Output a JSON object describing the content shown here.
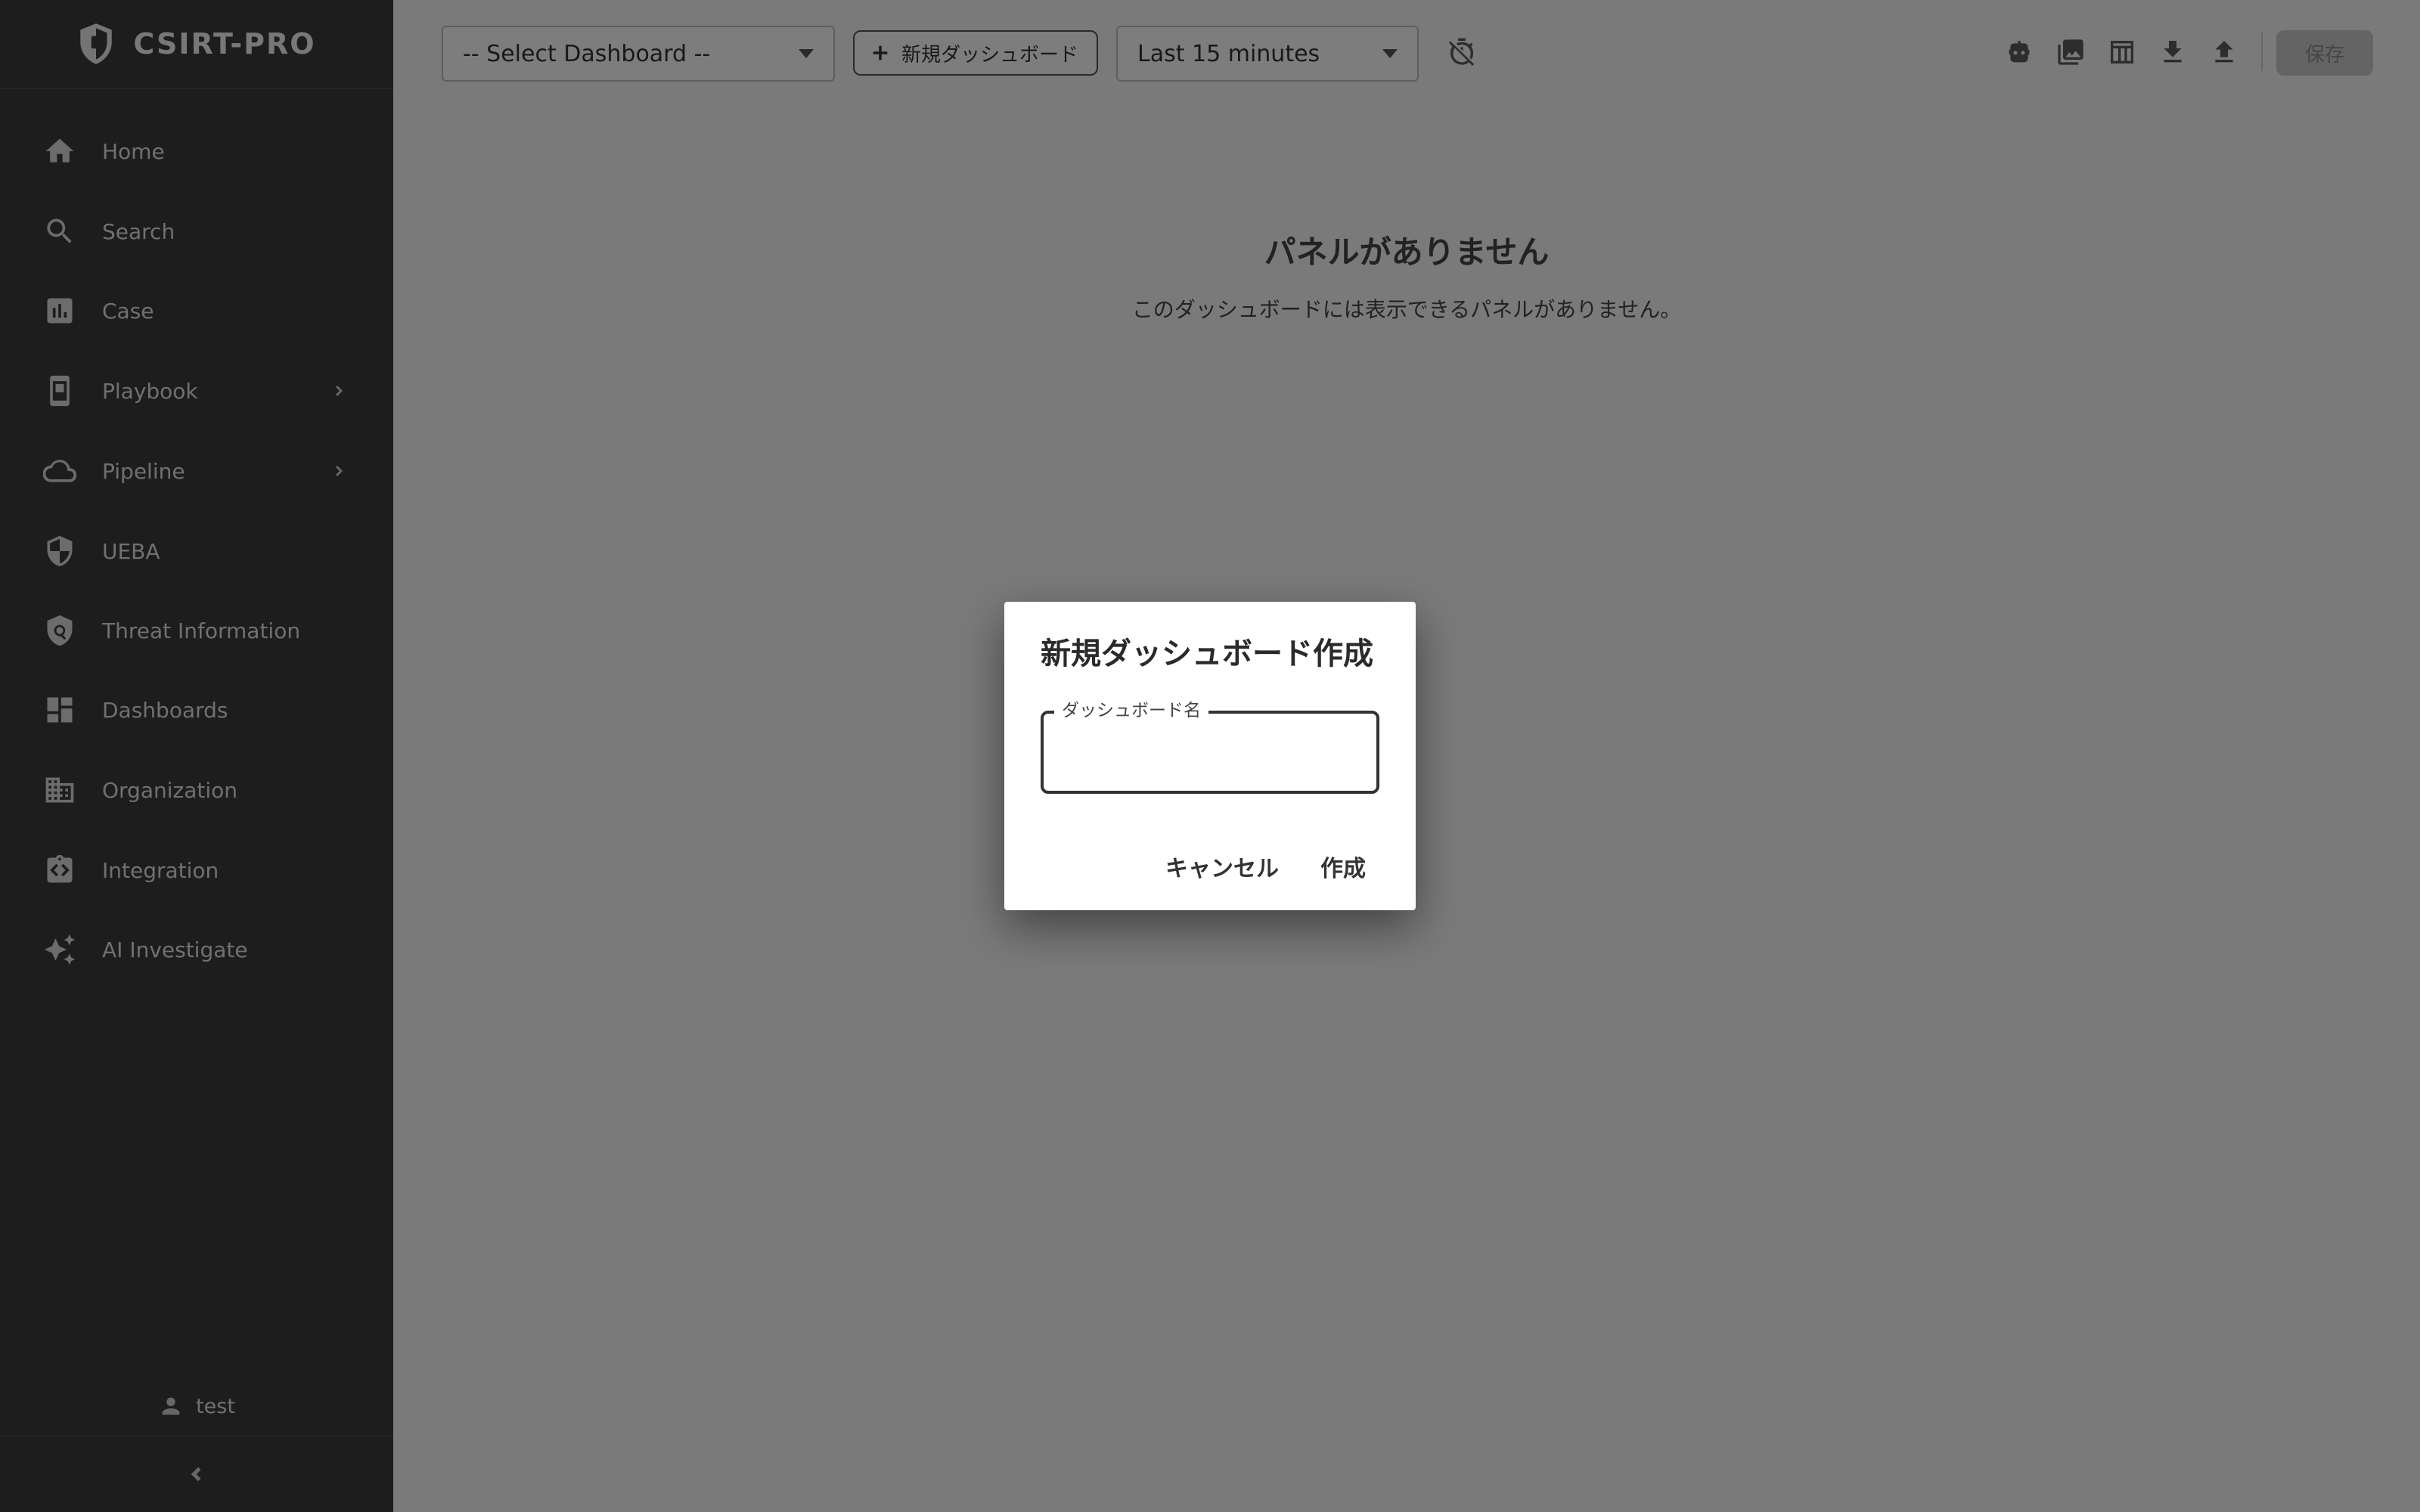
{
  "brand": {
    "title": "CSIRT-PRO",
    "icon": "shield-icon"
  },
  "sidebar": {
    "items": [
      {
        "label": "Home",
        "icon": "home-icon",
        "expandable": false
      },
      {
        "label": "Search",
        "icon": "search-icon",
        "expandable": false
      },
      {
        "label": "Case",
        "icon": "bar-chart-icon",
        "expandable": false
      },
      {
        "label": "Playbook",
        "icon": "book-icon",
        "expandable": true
      },
      {
        "label": "Pipeline",
        "icon": "cloud-icon",
        "expandable": true
      },
      {
        "label": "UEBA",
        "icon": "shield-half-icon",
        "expandable": false
      },
      {
        "label": "Threat Information",
        "icon": "shield-search-icon",
        "expandable": false
      },
      {
        "label": "Dashboards",
        "icon": "dashboard-icon",
        "expandable": false
      },
      {
        "label": "Organization",
        "icon": "building-icon",
        "expandable": false
      },
      {
        "label": "Integration",
        "icon": "integration-icon",
        "expandable": false
      },
      {
        "label": "AI Investigate",
        "icon": "sparkle-icon",
        "expandable": false
      }
    ],
    "user": "test"
  },
  "toolbar": {
    "dashboard_select": "-- Select Dashboard --",
    "new_dashboard_label": "新規ダッシュボード",
    "time_range": "Last 15 minutes",
    "save_label": "保存"
  },
  "main": {
    "empty_title": "パネルがありません",
    "empty_description": "このダッシュボードには表示できるパネルがありません。"
  },
  "dialog": {
    "title": "新規ダッシュボード作成",
    "field_label": "ダッシュボード名",
    "field_value": "",
    "cancel_label": "キャンセル",
    "create_label": "作成"
  },
  "colors": {
    "sidebar_bg": "#3a3a3a",
    "overlay": "rgba(0,0,0,0.5)",
    "dialog_bg": "#ffffff"
  }
}
